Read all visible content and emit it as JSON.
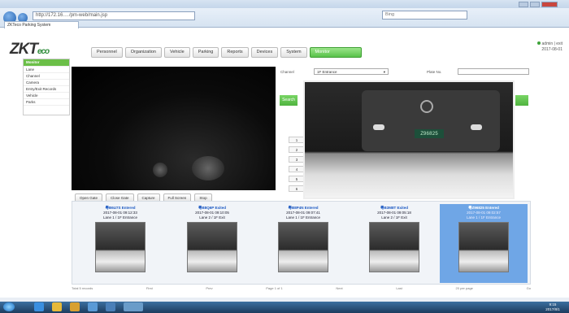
{
  "browser": {
    "url": "http://172.16.…/pm-web/main.jsp",
    "tab_title": "ZKTeco Parking System",
    "search_placeholder": "Bing"
  },
  "app": {
    "logo_main": "ZKT",
    "logo_accent": "eco",
    "user_line1": "admin | exit",
    "user_line2": "2017-08-01"
  },
  "menu": [
    {
      "label": "Personnel"
    },
    {
      "label": "Organization"
    },
    {
      "label": "Vehicle"
    },
    {
      "label": "Parking"
    },
    {
      "label": "Reports"
    },
    {
      "label": "Devices"
    },
    {
      "label": "System"
    },
    {
      "label": "Monitor"
    }
  ],
  "sidebar": [
    {
      "label": "Monitor",
      "active": true
    },
    {
      "label": "Lane"
    },
    {
      "label": "Channel"
    },
    {
      "label": "Camera"
    },
    {
      "label": "Entry/Exit Records"
    },
    {
      "label": "Vehicle"
    },
    {
      "label": "Parks"
    }
  ],
  "video_controls": [
    {
      "label": "Open Gate"
    },
    {
      "label": "Close Gate"
    },
    {
      "label": "Capture"
    },
    {
      "label": "Full Screen"
    },
    {
      "label": "Stop"
    }
  ],
  "form": {
    "channel_label": "Channel",
    "channel_value": "1F Entrance",
    "plate_label": "Plate No.",
    "search_button": "Search",
    "stub_labels": [
      "1",
      "2",
      "3",
      "4",
      "5",
      "6"
    ]
  },
  "popup": {
    "plate": "Z96825"
  },
  "thumbnails": [
    {
      "plate": "粤B6U7S Entered",
      "time": "2017-08-01 09:12:33",
      "lane": "Lane 1 / 1F Entrance"
    },
    {
      "plate": "粤B8Q6P Exited",
      "time": "2017-08-01 09:10:05",
      "lane": "Lane 2 / 1F Exit"
    },
    {
      "plate": "粤B8P4N Entered",
      "time": "2017-08-01 09:07:41",
      "lane": "Lane 1 / 1F Entrance"
    },
    {
      "plate": "粤B3M8T Exited",
      "time": "2017-08-01 09:05:18",
      "lane": "Lane 2 / 1F Exit"
    },
    {
      "plate": "粤Z96825 Entered",
      "time": "2017-08-01 09:02:57",
      "lane": "Lane 1 / 1F Entrance",
      "selected": true
    }
  ],
  "pager": {
    "items": [
      "Total 5 records",
      "First",
      "Prev",
      "Page 1 of 1",
      "Next",
      "Last",
      "20 per page",
      "Go"
    ]
  },
  "taskbar": {
    "time": "9:15",
    "date": "2017/8/1"
  }
}
